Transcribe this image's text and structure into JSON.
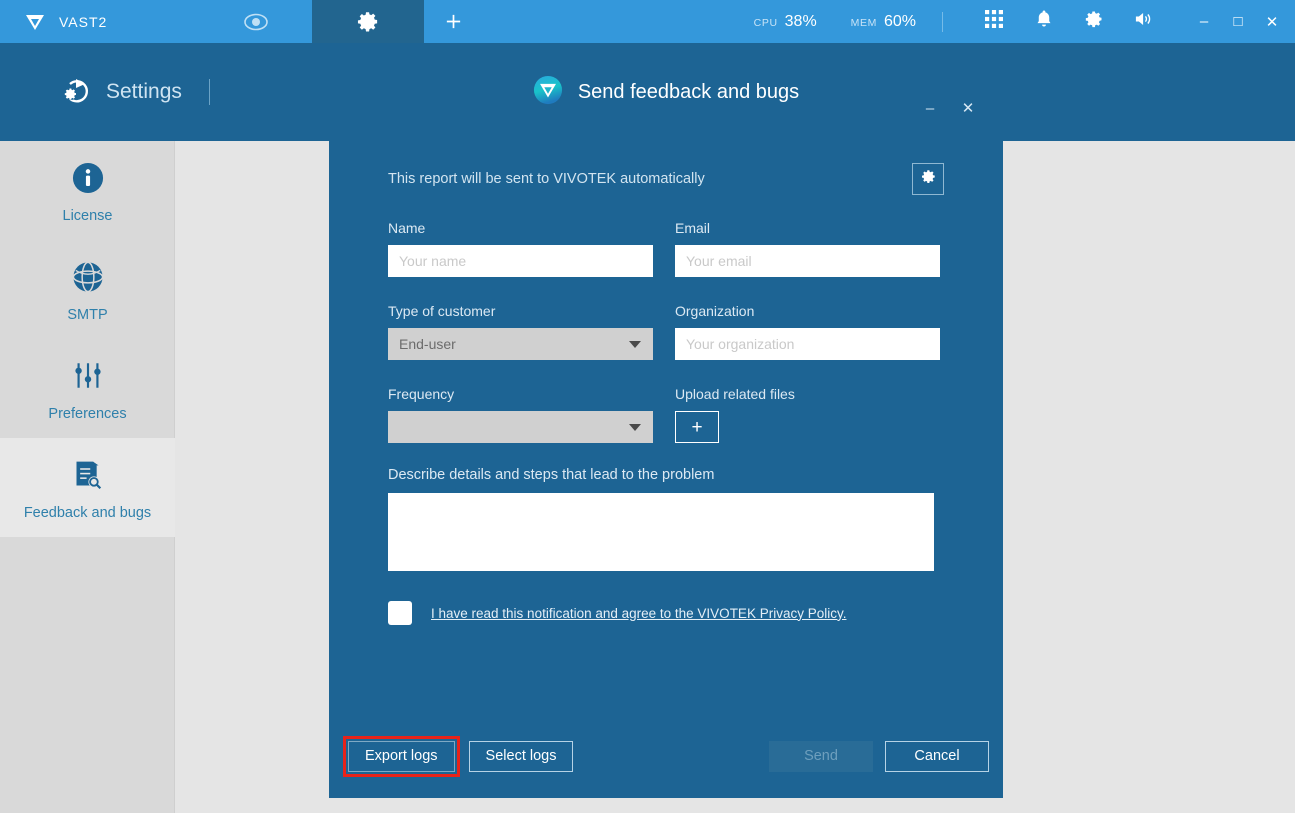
{
  "topbar": {
    "brand": "VAST2",
    "logo_icon": "vivotek-v-logo-icon",
    "tabs": [
      {
        "id": "liveview",
        "icon": "eye-icon",
        "active": false
      },
      {
        "id": "settings",
        "icon": "gear-icon",
        "active": true
      },
      {
        "id": "add",
        "icon": "plus-icon",
        "active": false
      }
    ],
    "stats": [
      {
        "label": "CPU",
        "value": "38%"
      },
      {
        "label": "MEM",
        "value": "60%"
      }
    ],
    "tray": [
      {
        "id": "apps",
        "icon": "grid-apps-icon"
      },
      {
        "id": "notifications",
        "icon": "bell-icon"
      },
      {
        "id": "settings",
        "icon": "gear-icon"
      },
      {
        "id": "volume",
        "icon": "speaker-icon"
      }
    ],
    "window_controls": {
      "minimize": "–",
      "maximize": "□",
      "close": "✕"
    }
  },
  "settings_header": {
    "icon": "settings-restore-icon",
    "title": "Settings"
  },
  "sidebar": {
    "items": [
      {
        "label": "License",
        "icon": "info-circle-icon",
        "active": false
      },
      {
        "label": "SMTP",
        "icon": "globe-icon",
        "active": false
      },
      {
        "label": "Preferences",
        "icon": "sliders-icon",
        "active": false
      },
      {
        "label": "Feedback and bugs",
        "icon": "document-search-icon",
        "active": true
      }
    ]
  },
  "dialog": {
    "logo_icon": "vivotek-circle-logo-icon",
    "title": "Send feedback and bugs",
    "window_controls": {
      "minimize": "–",
      "close": "✕"
    },
    "notice": "This report will be sent to VIVOTEK automatically",
    "notice_gear_icon": "gear-icon",
    "fields": {
      "name": {
        "label": "Name",
        "placeholder": "Your name",
        "value": ""
      },
      "email": {
        "label": "Email",
        "placeholder": "Your email",
        "value": ""
      },
      "type_of_customer": {
        "label": "Type of customer",
        "value": "End-user",
        "caret_icon": "chevron-down-icon"
      },
      "organization": {
        "label": "Organization",
        "placeholder": "Your organization",
        "value": ""
      },
      "frequency": {
        "label": "Frequency",
        "value": "",
        "caret_icon": "chevron-down-icon"
      },
      "upload": {
        "label": "Upload related files",
        "button_label": "+"
      },
      "describe": {
        "label": "Describe details and steps that lead to the problem",
        "value": "",
        "placeholder": ""
      }
    },
    "consent": {
      "checked": false,
      "text": "I have read this notification and agree to the VIVOTEK Privacy Policy."
    },
    "footer": {
      "export_logs": "Export logs",
      "select_logs": "Select logs",
      "send": "Send",
      "cancel": "Cancel",
      "send_enabled": false,
      "highlight_color": "#e8231a"
    }
  },
  "colors": {
    "topbar_blue": "#3498db",
    "active_tab_blue": "#22658f",
    "dialog_blue": "#1d6494",
    "page_background": "#e5e5e5",
    "sidebar_background": "#d9d9d9",
    "sidebar_active": "#e8e8e8",
    "link_blue": "#2f80ab",
    "highlight_red": "#e8231a"
  }
}
